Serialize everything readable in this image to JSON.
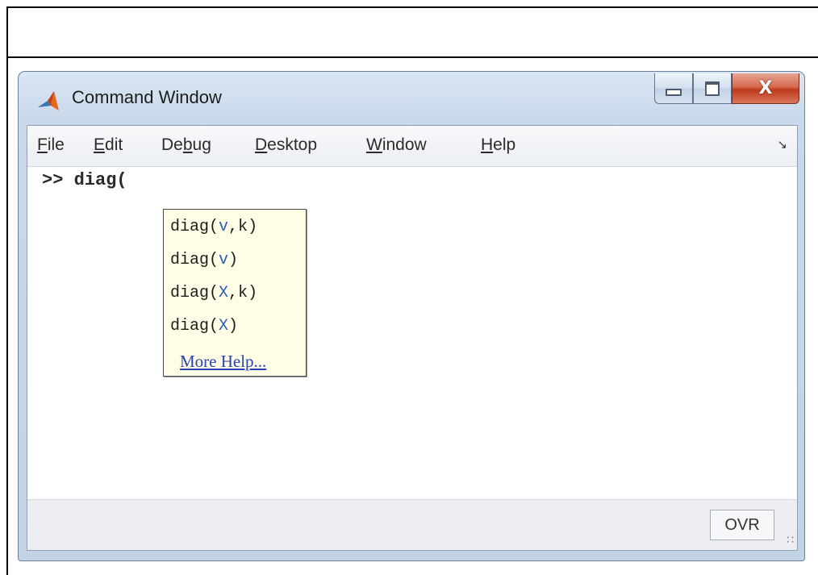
{
  "window": {
    "title": "Command Window",
    "controls": {
      "minimize": "minimize",
      "maximize": "maximize",
      "close": "X"
    }
  },
  "menubar": {
    "items": [
      {
        "pre": "",
        "mnemonic": "F",
        "post": "ile"
      },
      {
        "pre": "",
        "mnemonic": "E",
        "post": "dit"
      },
      {
        "pre": "De",
        "mnemonic": "b",
        "post": "ug"
      },
      {
        "pre": "",
        "mnemonic": "D",
        "post": "esktop"
      },
      {
        "pre": "",
        "mnemonic": "W",
        "post": "indow"
      },
      {
        "pre": "",
        "mnemonic": "H",
        "post": "elp"
      }
    ],
    "undock_icon": "undock-arrow-icon"
  },
  "console": {
    "prompt": ">> ",
    "input": "diag("
  },
  "function_hints": {
    "signatures": [
      {
        "name": "diag(",
        "args": [
          "v",
          ",",
          "k"
        ],
        "close": ")"
      },
      {
        "name": "diag(",
        "args": [
          "v"
        ],
        "close": ")"
      },
      {
        "name": "diag(",
        "args": [
          "X",
          ",",
          "k"
        ],
        "close": ")"
      },
      {
        "name": "diag(",
        "args": [
          "X"
        ],
        "close": ")"
      }
    ],
    "more_help": "More Help..."
  },
  "statusbar": {
    "mode": "OVR"
  },
  "colors": {
    "hint_background": "#fffde6",
    "argument_blue": "#2b5fb8",
    "link_blue": "#2743b5",
    "close_red": "#c0391b"
  }
}
